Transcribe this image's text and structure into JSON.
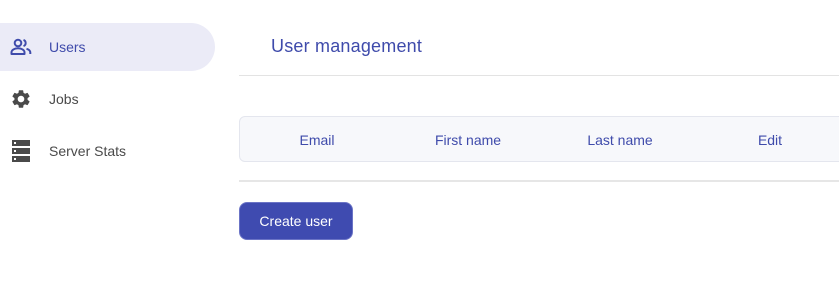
{
  "sidebar": {
    "items": [
      {
        "label": "Users",
        "icon": "users-icon",
        "active": true
      },
      {
        "label": "Jobs",
        "icon": "gear-icon",
        "active": false
      },
      {
        "label": "Server Stats",
        "icon": "server-icon",
        "active": false
      }
    ]
  },
  "main": {
    "title": "User management",
    "table": {
      "columns": [
        "Email",
        "First name",
        "Last name",
        "Edit"
      ],
      "rows": []
    },
    "create_button_label": "Create user"
  },
  "colors": {
    "accent": "#3f4bab",
    "active_nav_bg": "#ebebf7",
    "button_bg": "#3f4bb0",
    "icon_color": "#4a4a4a"
  }
}
